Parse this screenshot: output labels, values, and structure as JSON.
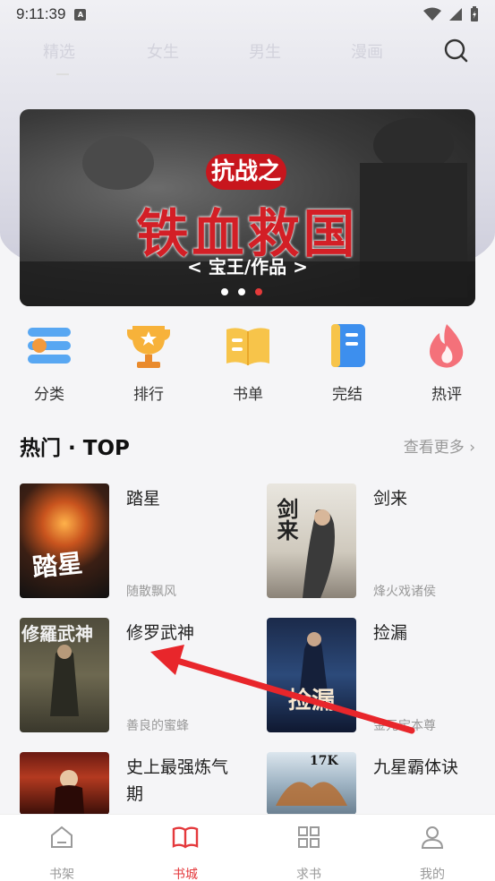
{
  "status_bar": {
    "time": "9:11:39",
    "indicator": "A"
  },
  "top_nav": {
    "tabs": [
      "精选",
      "女生",
      "男生",
      "漫画"
    ]
  },
  "banner": {
    "title_top": "抗战之",
    "title": "铁血救国",
    "subtitle": "< 宝王/作品 >",
    "slides": 3,
    "active_slide": 3
  },
  "categories": [
    {
      "label": "分类",
      "icon": "category-icon"
    },
    {
      "label": "排行",
      "icon": "trophy-icon"
    },
    {
      "label": "书单",
      "icon": "booklist-icon"
    },
    {
      "label": "完结",
      "icon": "finished-book-icon"
    },
    {
      "label": "热评",
      "icon": "flame-icon"
    }
  ],
  "section": {
    "title": "热门 · TOP",
    "more": "查看更多"
  },
  "books": [
    {
      "title": "踏星",
      "author": "随散飘风",
      "cover_text": "踏星"
    },
    {
      "title": "剑来",
      "author": "烽火戏诸侯",
      "cover_text": "剑来"
    },
    {
      "title": "修罗武神",
      "author": "善良的蜜蜂",
      "cover_text": "修羅武神"
    },
    {
      "title": "捡漏",
      "author": "金元宝本尊",
      "cover_text": "捡漏"
    },
    {
      "title": "史上最强炼气期",
      "author": "",
      "cover_text": ""
    },
    {
      "title": "九星霸体诀",
      "author": "",
      "cover_text": "17K"
    }
  ],
  "tabbar": [
    {
      "label": "书架",
      "icon": "home-icon",
      "active": false
    },
    {
      "label": "书城",
      "icon": "book-open-icon",
      "active": true
    },
    {
      "label": "求书",
      "icon": "grid-icon",
      "active": false
    },
    {
      "label": "我的",
      "icon": "user-icon",
      "active": false
    }
  ],
  "colors": {
    "accent": "#e4393c",
    "arrow": "#e8262b"
  }
}
